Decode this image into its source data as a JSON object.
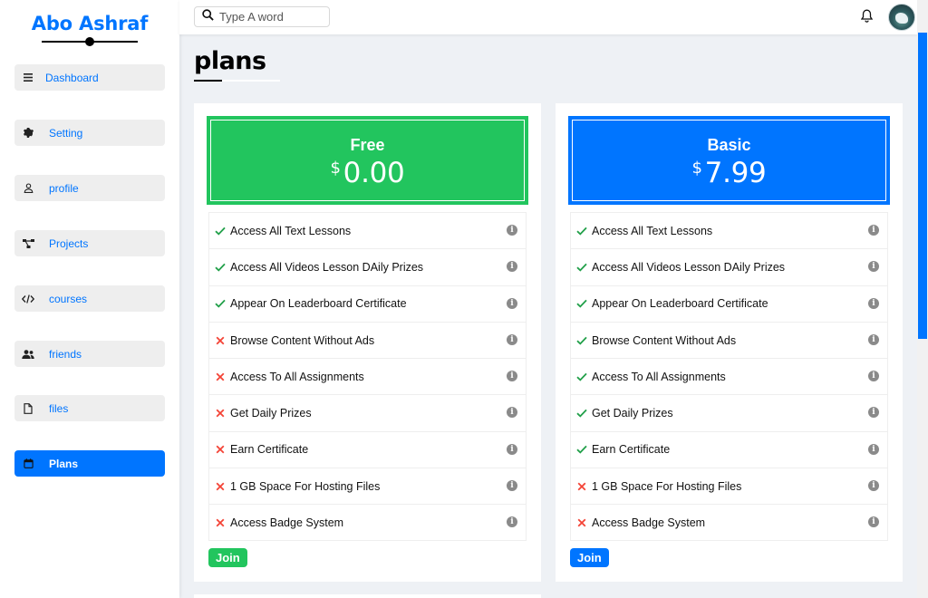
{
  "brand": {
    "name": "Abo Ashraf"
  },
  "sidebar": {
    "items": [
      {
        "label": "Dashboard",
        "icon": "menu-icon",
        "active": false
      },
      {
        "label": "Setting",
        "icon": "gear-icon",
        "active": false
      },
      {
        "label": "profile",
        "icon": "user-icon",
        "active": false
      },
      {
        "label": "Projects",
        "icon": "diagram-icon",
        "active": false
      },
      {
        "label": "courses",
        "icon": "code-icon",
        "active": false
      },
      {
        "label": "friends",
        "icon": "users-icon",
        "active": false
      },
      {
        "label": "files",
        "icon": "file-icon",
        "active": false
      },
      {
        "label": "Plans",
        "icon": "calendar-icon",
        "active": true
      }
    ]
  },
  "header": {
    "search_placeholder": "Type A word",
    "bell_icon": "bell-icon",
    "avatar_icon": "avatar"
  },
  "page": {
    "title": "plans"
  },
  "colors": {
    "accent": "#0075ff",
    "free": "#22c55e",
    "check": "#22a04a",
    "cross": "#f44336"
  },
  "plans": [
    {
      "name": "Free",
      "currency": "$",
      "price": "0.00",
      "color": "#22c55e",
      "join_label": "Join",
      "features": [
        {
          "text": "Access All Text Lessons",
          "included": true
        },
        {
          "text": "Access All Videos Lesson DAily Prizes",
          "included": true
        },
        {
          "text": "Appear On Leaderboard Certificate",
          "included": true
        },
        {
          "text": "Browse Content Without Ads",
          "included": false
        },
        {
          "text": "Access To All Assignments",
          "included": false
        },
        {
          "text": "Get Daily Prizes",
          "included": false
        },
        {
          "text": "Earn Certificate",
          "included": false
        },
        {
          "text": "1 GB Space For Hosting Files",
          "included": false
        },
        {
          "text": "Access Badge System",
          "included": false
        }
      ]
    },
    {
      "name": "Basic",
      "currency": "$",
      "price": "7.99",
      "color": "#0075ff",
      "join_label": "Join",
      "features": [
        {
          "text": "Access All Text Lessons",
          "included": true
        },
        {
          "text": "Access All Videos Lesson DAily Prizes",
          "included": true
        },
        {
          "text": "Appear On Leaderboard Certificate",
          "included": true
        },
        {
          "text": "Browse Content Without Ads",
          "included": true
        },
        {
          "text": "Access To All Assignments",
          "included": true
        },
        {
          "text": "Get Daily Prizes",
          "included": true
        },
        {
          "text": "Earn Certificate",
          "included": true
        },
        {
          "text": "1 GB Space For Hosting Files",
          "included": false
        },
        {
          "text": "Access Badge System",
          "included": false
        }
      ]
    }
  ]
}
